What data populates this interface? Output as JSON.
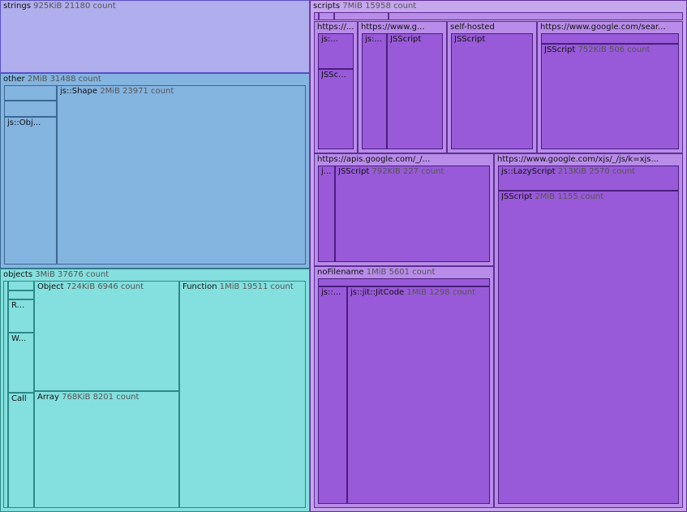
{
  "chart_data": {
    "type": "treemap",
    "colors": {
      "strings": "#b0aeec",
      "other": "#84b4e0",
      "objects": "#84e0de",
      "scripts": "#c6a6ec",
      "scripts_child": "#b88ce8",
      "scripts_leaf": "#985ad8"
    },
    "nodes": [
      {
        "id": "strings",
        "name": "strings",
        "meta": "925KiB 21180 count",
        "group": "strings",
        "depth": 0
      },
      {
        "id": "other",
        "name": "other",
        "meta": "2MiB 31488 count",
        "group": "other",
        "depth": 0
      },
      {
        "id": "other-a",
        "name": "",
        "meta": "",
        "group": "other",
        "depth": 1
      },
      {
        "id": "other-b",
        "name": "",
        "meta": "",
        "group": "other",
        "depth": 1
      },
      {
        "id": "other-jsobj",
        "name": "js::Obj...",
        "meta": "",
        "group": "other",
        "depth": 1
      },
      {
        "id": "other-shape",
        "name": "js::Shape",
        "meta": "2MiB 23971 count",
        "group": "other",
        "depth": 1
      },
      {
        "id": "objects",
        "name": "objects",
        "meta": "3MiB 37676 count",
        "group": "objects",
        "depth": 0
      },
      {
        "id": "obj-strip",
        "name": "",
        "meta": "",
        "group": "objects",
        "depth": 1
      },
      {
        "id": "obj-s1",
        "name": "",
        "meta": "",
        "group": "objects",
        "depth": 1
      },
      {
        "id": "obj-s2",
        "name": "",
        "meta": "",
        "group": "objects",
        "depth": 1
      },
      {
        "id": "obj-r",
        "name": "R...",
        "meta": "",
        "group": "objects",
        "depth": 1
      },
      {
        "id": "obj-w",
        "name": "W...",
        "meta": "",
        "group": "objects",
        "depth": 1
      },
      {
        "id": "obj-call",
        "name": "Call",
        "meta": "",
        "group": "objects",
        "depth": 1
      },
      {
        "id": "obj-object",
        "name": "Object",
        "meta": "724KiB 6946 count",
        "group": "objects",
        "depth": 1
      },
      {
        "id": "obj-array",
        "name": "Array",
        "meta": "768KiB 8201 count",
        "group": "objects",
        "depth": 1
      },
      {
        "id": "obj-function",
        "name": "Function",
        "meta": "1MiB 19511 count",
        "group": "objects",
        "depth": 1
      },
      {
        "id": "scripts",
        "name": "scripts",
        "meta": "7MiB 15958 count",
        "group": "scripts",
        "depth": 0
      },
      {
        "id": "sc-t1",
        "name": "",
        "meta": "",
        "group": "scripts",
        "depth": 1
      },
      {
        "id": "sc-t2",
        "name": "",
        "meta": "",
        "group": "scripts",
        "depth": 1
      },
      {
        "id": "sc-t3",
        "name": "",
        "meta": "",
        "group": "scripts",
        "depth": 1
      },
      {
        "id": "sc-t4",
        "name": "",
        "meta": "",
        "group": "scripts",
        "depth": 1
      },
      {
        "id": "sc-https1",
        "name": "https://...",
        "meta": "",
        "group": "scripts",
        "depth": 1
      },
      {
        "id": "sc-https1-js",
        "name": "js:...",
        "meta": "",
        "group": "scripts",
        "depth": 2
      },
      {
        "id": "sc-https1-jssc",
        "name": "JSSc...",
        "meta": "",
        "group": "scripts",
        "depth": 2
      },
      {
        "id": "sc-wwwg",
        "name": "https://www.g...",
        "meta": "",
        "group": "scripts",
        "depth": 1
      },
      {
        "id": "sc-wwwg-js",
        "name": "js:...",
        "meta": "",
        "group": "scripts",
        "depth": 2
      },
      {
        "id": "sc-wwwg-jsscript",
        "name": "JSScript",
        "meta": "",
        "group": "scripts",
        "depth": 2
      },
      {
        "id": "sc-selfhosted",
        "name": "self-hosted",
        "meta": "",
        "group": "scripts",
        "depth": 1
      },
      {
        "id": "sc-selfhosted-jsscript",
        "name": "JSScript",
        "meta": "",
        "group": "scripts",
        "depth": 2
      },
      {
        "id": "sc-googlesear",
        "name": "https://www.google.com/sear...",
        "meta": "",
        "group": "scripts",
        "depth": 1
      },
      {
        "id": "sc-googlesear-top",
        "name": "",
        "meta": "",
        "group": "scripts",
        "depth": 2
      },
      {
        "id": "sc-googlesear-jsscript",
        "name": "JSScript",
        "meta": "752KiB 506 count",
        "group": "scripts",
        "depth": 2
      },
      {
        "id": "sc-apis",
        "name": "https://apis.google.com/_/...",
        "meta": "",
        "group": "scripts",
        "depth": 1
      },
      {
        "id": "sc-apis-j",
        "name": "j...",
        "meta": "",
        "group": "scripts",
        "depth": 2
      },
      {
        "id": "sc-apis-jsscript",
        "name": "JSScript",
        "meta": "792KiB 227 count",
        "group": "scripts",
        "depth": 2
      },
      {
        "id": "sc-xjs",
        "name": "https://www.google.com/xjs/_/js/k=xjs...",
        "meta": "",
        "group": "scripts",
        "depth": 1
      },
      {
        "id": "sc-xjs-lazy",
        "name": "js::LazyScript",
        "meta": "213KiB 2570 count",
        "group": "scripts",
        "depth": 2
      },
      {
        "id": "sc-xjs-jsscript",
        "name": "JSScript",
        "meta": "2MiB 1155 count",
        "group": "scripts",
        "depth": 2
      },
      {
        "id": "sc-nofilename",
        "name": "noFilename",
        "meta": "1MiB 5601 count",
        "group": "scripts",
        "depth": 1
      },
      {
        "id": "sc-nof-top",
        "name": "",
        "meta": "",
        "group": "scripts",
        "depth": 2
      },
      {
        "id": "sc-nof-js",
        "name": "js::...",
        "meta": "",
        "group": "scripts",
        "depth": 2
      },
      {
        "id": "sc-nof-jit",
        "name": "js::jit::JitCode",
        "meta": "1MiB 1298 count",
        "group": "scripts",
        "depth": 2
      }
    ]
  }
}
